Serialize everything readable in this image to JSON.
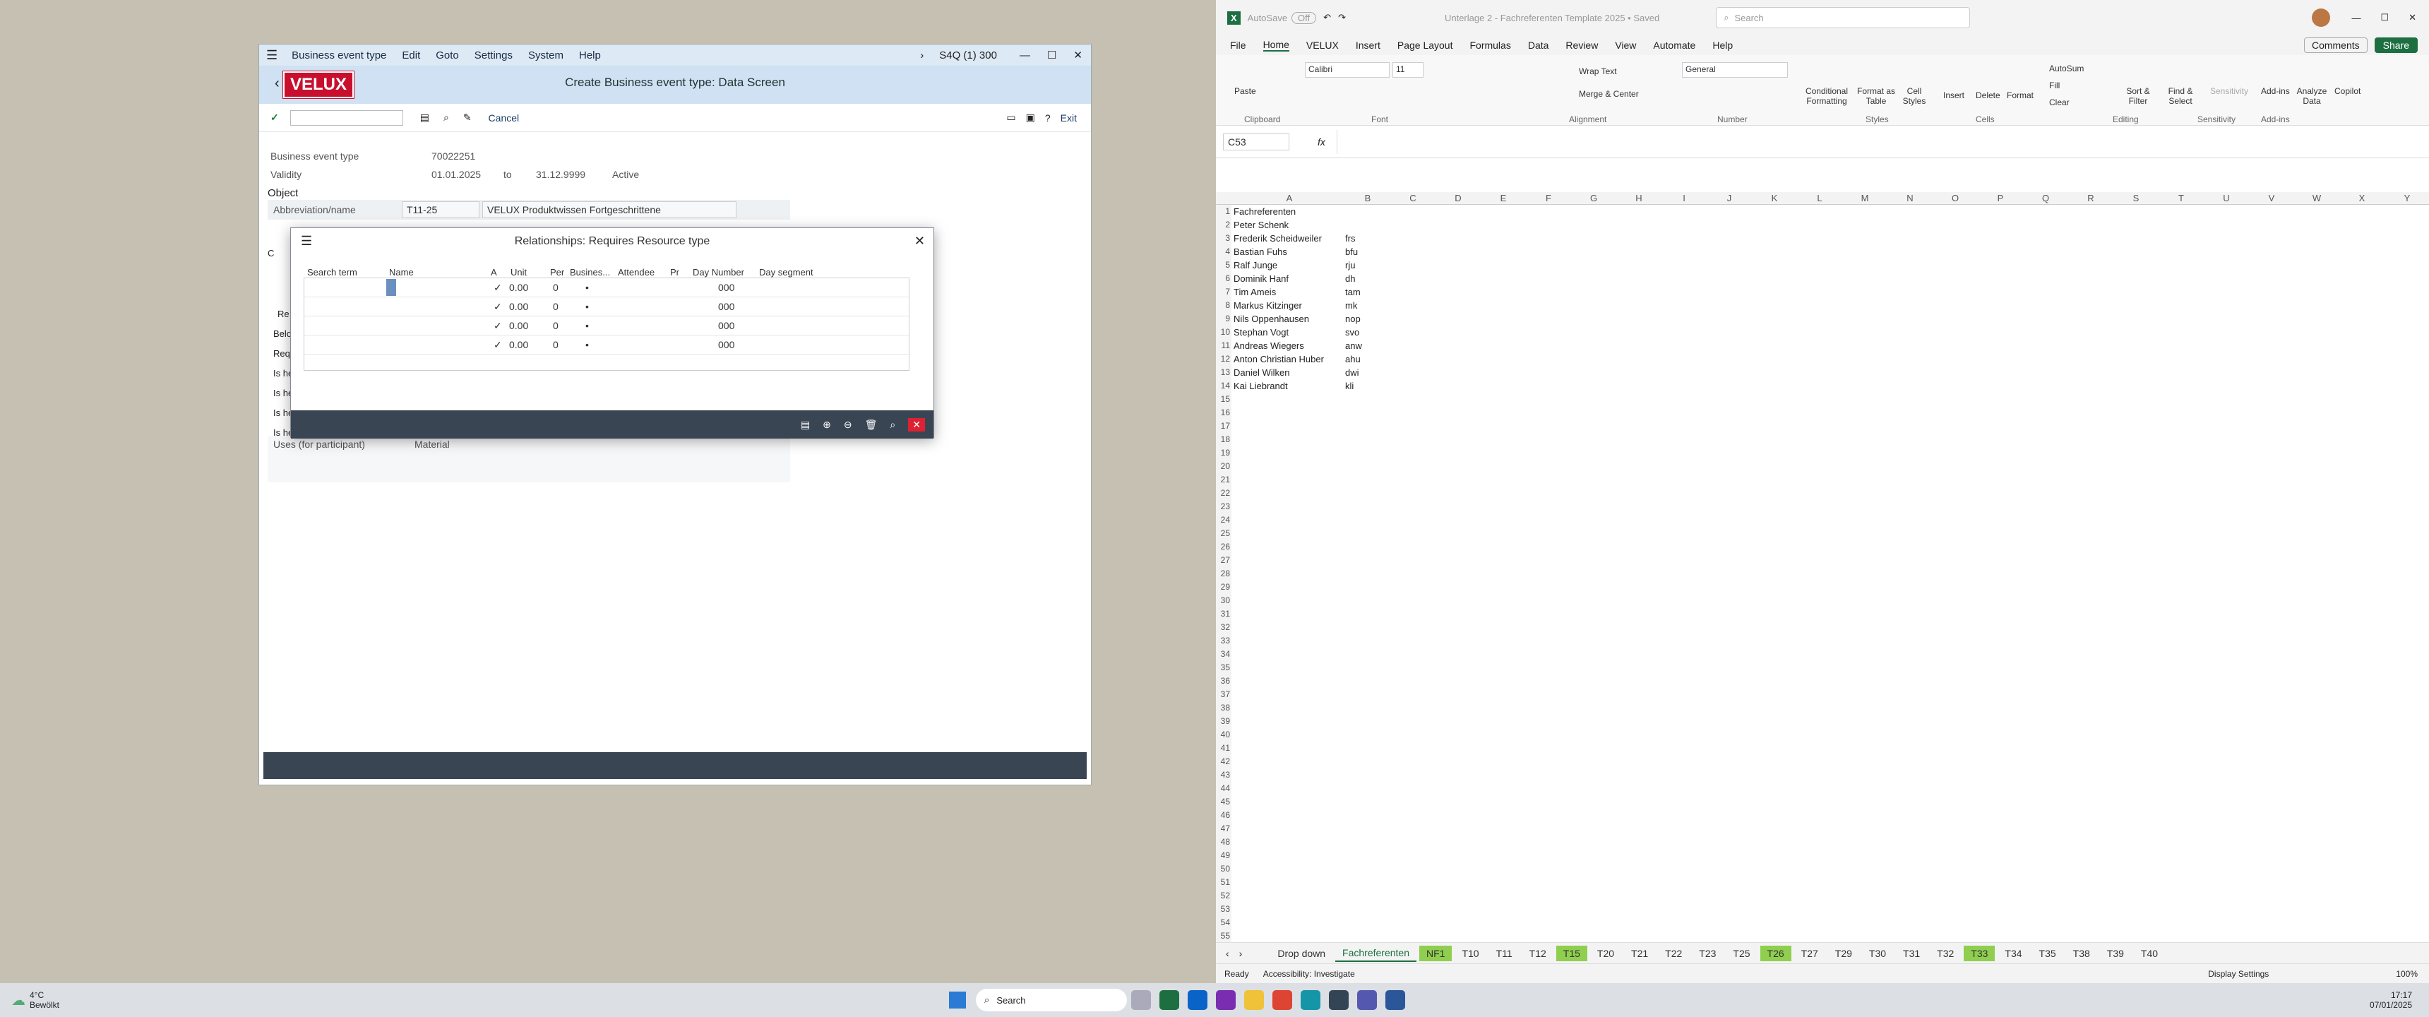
{
  "sap": {
    "menu": [
      "Business event type",
      "Edit",
      "Goto",
      "Settings",
      "System",
      "Help"
    ],
    "system": "S4Q (1) 300",
    "logo": "VELUX",
    "title": "Create Business event type: Data Screen",
    "cancel": "Cancel",
    "exit": "Exit",
    "bet_label": "Business event type",
    "bet_value": "70022251",
    "validity_label": "Validity",
    "validity_from": "01.01.2025",
    "validity_to_word": "to",
    "validity_to": "31.12.9999",
    "status": "Active",
    "object_label": "Object",
    "abbrev_label": "Abbreviation/name",
    "abbrev": "T11-25",
    "name": "VELUX Produktwissen Fortgeschrittene",
    "uses_label": "Uses (for participant)",
    "uses_value": "Material",
    "left_labels": [
      "C",
      "Re",
      "Belo",
      "Requ",
      "Is he",
      "Is he",
      "Is he",
      "Is he"
    ]
  },
  "dialog": {
    "title": "Relationships: Requires Resource type",
    "headers": [
      "Search term",
      "Name",
      "A",
      "Unit",
      "Per",
      "Busines...",
      "Attendee",
      "Pr",
      "Day Number",
      "Day segment"
    ],
    "rows": [
      {
        "check": "✓",
        "unit": "0.00",
        "per": "0",
        "bus": "•",
        "day": "000"
      },
      {
        "check": "✓",
        "unit": "0.00",
        "per": "0",
        "bus": "•",
        "day": "000"
      },
      {
        "check": "✓",
        "unit": "0.00",
        "per": "0",
        "bus": "•",
        "day": "000"
      },
      {
        "check": "✓",
        "unit": "0.00",
        "per": "0",
        "bus": "•",
        "day": "000"
      }
    ]
  },
  "excel": {
    "autosave": "AutoSave",
    "autosave_state": "Off",
    "filename": "Unterlage 2 - Fachreferenten Template 2025 • Saved",
    "search": "Search",
    "menu": [
      "File",
      "Home",
      "VELUX",
      "Insert",
      "Page Layout",
      "Formulas",
      "Data",
      "Review",
      "View",
      "Automate",
      "Help"
    ],
    "comments": "Comments",
    "share": "Share",
    "font": "Calibri",
    "fontsize": "11",
    "numformat": "General",
    "groups": [
      "Clipboard",
      "Font",
      "Alignment",
      "Number",
      "Styles",
      "Cells",
      "Editing",
      "Sensitivity",
      "Add-ins"
    ],
    "ribbon_btns": [
      "Paste",
      "Wrap Text",
      "Merge & Center",
      "Conditional Formatting",
      "Format as Table",
      "Cell Styles",
      "Insert",
      "Delete",
      "Format",
      "AutoSum",
      "Fill",
      "Clear",
      "Sort & Filter",
      "Find & Select",
      "Sensitivity",
      "Add-ins",
      "Analyze Data",
      "Copilot"
    ],
    "namebox": "C53",
    "fx": "fx",
    "cols": [
      "A",
      "B",
      "C",
      "D",
      "E",
      "F",
      "G",
      "H",
      "I",
      "J",
      "K",
      "L",
      "M",
      "N",
      "O",
      "P",
      "Q",
      "R",
      "S",
      "T",
      "U",
      "V",
      "W",
      "X",
      "Y"
    ],
    "cells": [
      [
        "Fachreferenten",
        ""
      ],
      [
        "Peter Schenk",
        ""
      ],
      [
        "Frederik Scheidweiler",
        "frs"
      ],
      [
        "Bastian Fuhs",
        "bfu"
      ],
      [
        "Ralf Junge",
        "rju"
      ],
      [
        "Dominik Hanf",
        "dh"
      ],
      [
        "Tim Ameis",
        "tam"
      ],
      [
        "Markus Kitzinger",
        "mk"
      ],
      [
        "Nils Oppenhausen",
        "nop"
      ],
      [
        "Stephan Vogt",
        "svo"
      ],
      [
        "Andreas Wiegers",
        "anw"
      ],
      [
        "Anton Christian Huber",
        "ahu"
      ],
      [
        "Daniel Wilken",
        "dwi"
      ],
      [
        "Kai Liebrandt",
        "kli"
      ]
    ],
    "rowcount": 55,
    "tabs": [
      {
        "n": "Drop down",
        "hl": false
      },
      {
        "n": "Fachreferenten",
        "hl": false,
        "active": true
      },
      {
        "n": "NF1",
        "hl": true
      },
      {
        "n": "T10",
        "hl": false
      },
      {
        "n": "T11",
        "hl": false
      },
      {
        "n": "T12",
        "hl": false
      },
      {
        "n": "T15",
        "hl": true
      },
      {
        "n": "T20",
        "hl": false
      },
      {
        "n": "T21",
        "hl": false
      },
      {
        "n": "T22",
        "hl": false
      },
      {
        "n": "T23",
        "hl": false
      },
      {
        "n": "T25",
        "hl": false
      },
      {
        "n": "T26",
        "hl": true
      },
      {
        "n": "T27",
        "hl": false
      },
      {
        "n": "T29",
        "hl": false
      },
      {
        "n": "T30",
        "hl": false
      },
      {
        "n": "T31",
        "hl": false
      },
      {
        "n": "T32",
        "hl": false
      },
      {
        "n": "T33",
        "hl": true
      },
      {
        "n": "T34",
        "hl": false
      },
      {
        "n": "T35",
        "hl": false
      },
      {
        "n": "T38",
        "hl": false
      },
      {
        "n": "T39",
        "hl": false
      },
      {
        "n": "T40",
        "hl": false
      }
    ],
    "status_ready": "Ready",
    "status_access": "Accessibility: Investigate",
    "display_settings": "Display Settings",
    "zoom": "100%"
  },
  "taskbar": {
    "temp": "4°C",
    "weather": "Bewölkt",
    "search": "Search",
    "time": "17:17",
    "date": "07/01/2025"
  },
  "colors": {
    "velux": "#c8102e",
    "excel_green": "#8fce4f",
    "sap_blue": "#cfe1f3"
  }
}
